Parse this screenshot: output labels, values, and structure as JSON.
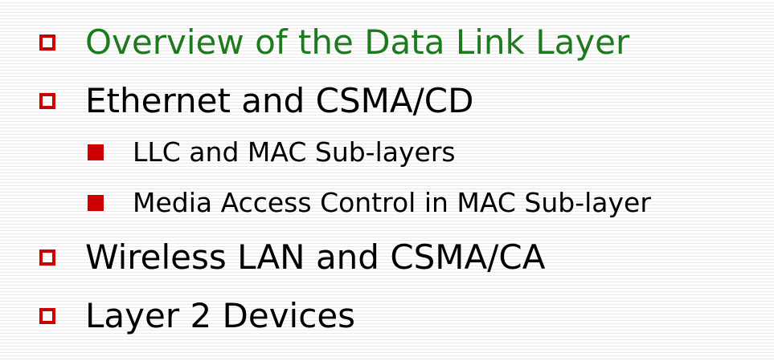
{
  "slide": {
    "colors": {
      "bullet": "#cc0000",
      "active_text": "#1f7a1f",
      "text": "#000000"
    },
    "items": [
      {
        "text": "Overview of the Data Link Layer",
        "level": 1,
        "active": true
      },
      {
        "text": "Ethernet and CSMA/CD",
        "level": 1,
        "active": false
      },
      {
        "text": "LLC and MAC Sub-layers",
        "level": 2,
        "active": false
      },
      {
        "text": "Media Access Control in MAC Sub-layer",
        "level": 2,
        "active": false
      },
      {
        "text": "Wireless LAN and CSMA/CA",
        "level": 1,
        "active": false
      },
      {
        "text": "Layer 2 Devices",
        "level": 1,
        "active": false
      }
    ]
  }
}
